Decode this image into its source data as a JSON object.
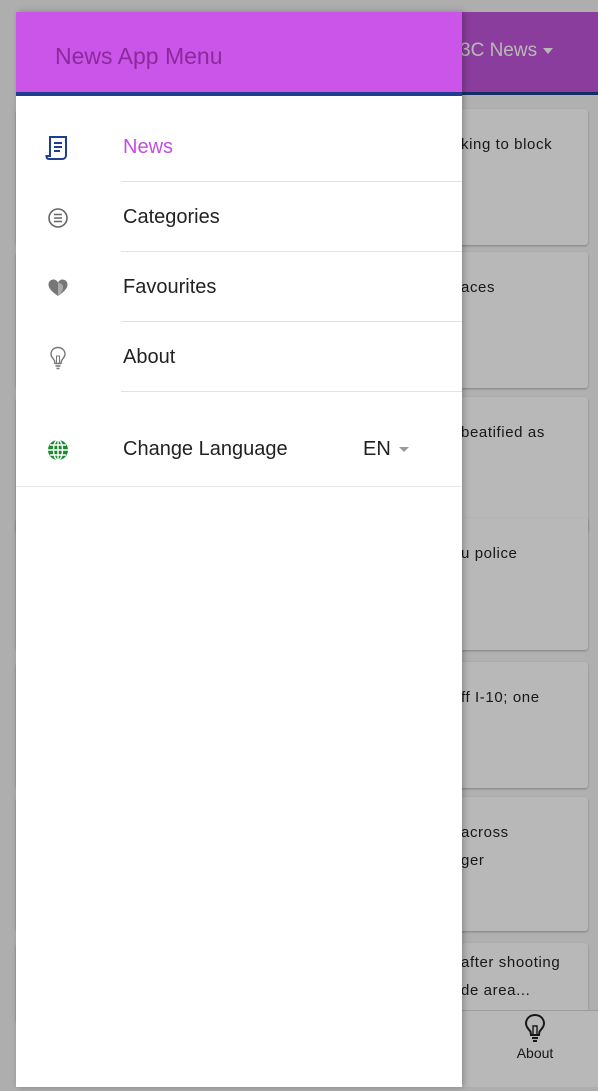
{
  "drawer": {
    "title": "News App Menu",
    "items": [
      {
        "label": "News",
        "icon": "news-icon",
        "active": true
      },
      {
        "label": "Categories",
        "icon": "list-icon",
        "active": false
      },
      {
        "label": "Favourites",
        "icon": "heart-icon",
        "active": false
      },
      {
        "label": "About",
        "icon": "lightbulb-icon",
        "active": false
      }
    ],
    "language": {
      "label": "Change Language",
      "icon": "globe-icon",
      "value": "EN"
    }
  },
  "background": {
    "source_label": "3C News",
    "cards": [
      {
        "text": "king to block"
      },
      {
        "text": "aces"
      },
      {
        "text": "beatified as"
      },
      {
        "text": "u police"
      },
      {
        "text": "ff I-10; one"
      },
      {
        "text": "across\nger"
      },
      {
        "text": "after shooting\nde area..."
      }
    ],
    "bottom_nav": {
      "about_label": "About"
    }
  },
  "colors": {
    "header": "#cb55e9",
    "header_rule": "#1e3f8f",
    "active": "#c54ce6",
    "globe": "#1a8a2e"
  }
}
